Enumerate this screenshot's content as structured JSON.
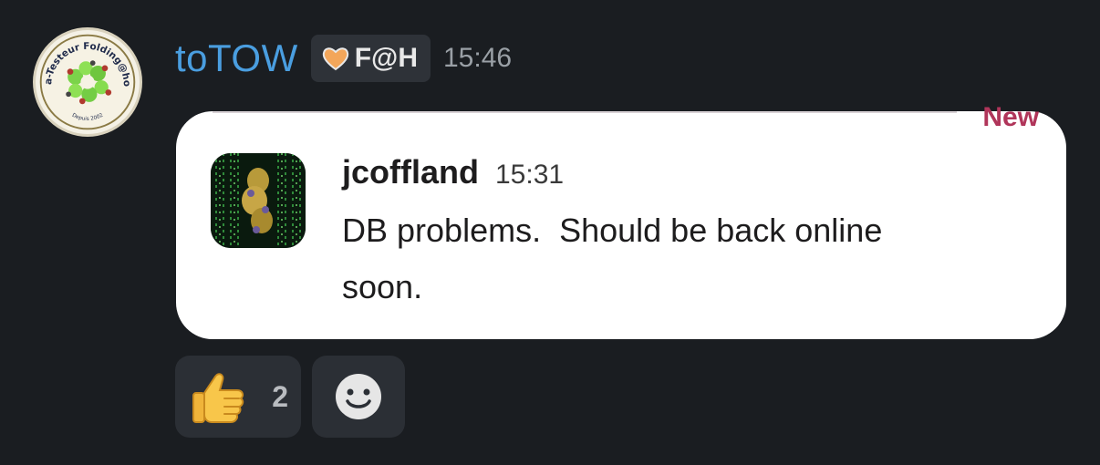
{
  "message": {
    "author": "toTOW",
    "status_badge": "F@H",
    "status_icon": "orange-heart-icon",
    "time": "15:46",
    "avatar_text": {
      "top": "Béta-Testeur Folding@home",
      "bottom": "Depuis 2002"
    }
  },
  "shared": {
    "new_label": "New",
    "author": "jcoffland",
    "time": "15:31",
    "text": "DB problems.  Should be back online\nsoon."
  },
  "reactions": [
    {
      "icon": "thumbs-up-icon",
      "count": "2"
    },
    {
      "icon": "add-reaction-icon"
    }
  ],
  "colors": {
    "background": "#1a1d21",
    "author_name": "#4a9ee0",
    "new_label": "#b0355a",
    "card": "#ffffff"
  }
}
